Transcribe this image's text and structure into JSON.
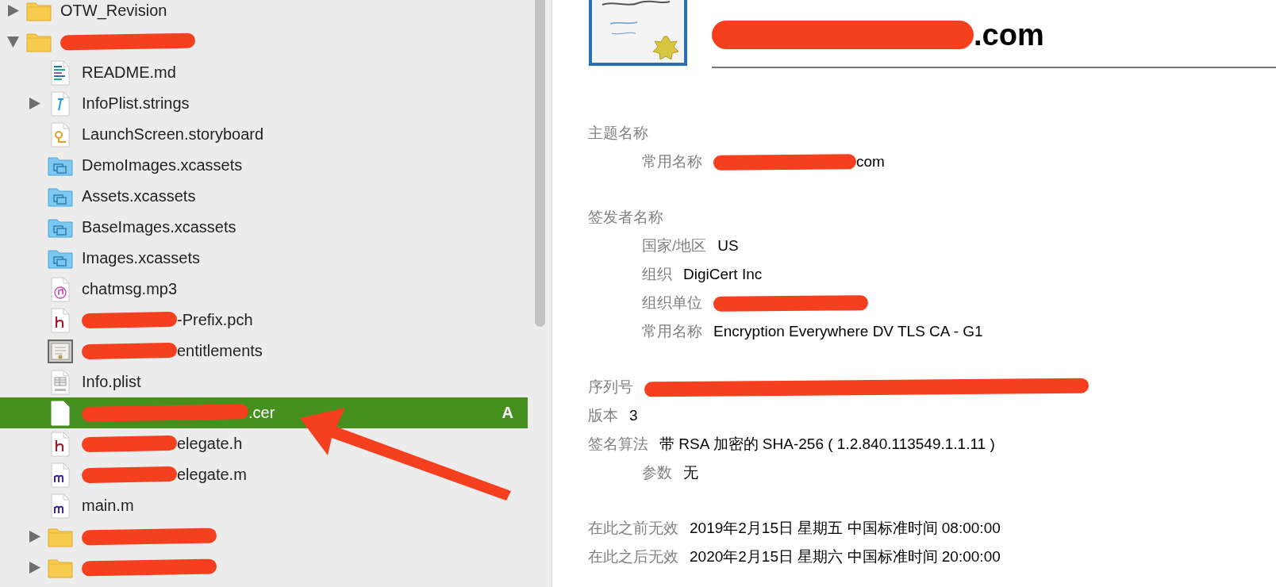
{
  "sidebar": {
    "items": [
      {
        "name": "OTW_Revision",
        "kind": "folder",
        "expanded": false
      },
      {
        "kind": "folder",
        "expanded": true,
        "redacted": true,
        "children": [
          {
            "name": "README.md",
            "kind": "markdown",
            "selected": false
          },
          {
            "name": "InfoPlist.strings",
            "kind": "strings",
            "expanded": false,
            "selected": false
          },
          {
            "name": "LaunchScreen.storyboard",
            "kind": "storyboard",
            "selected": false
          },
          {
            "name": "DemoImages.xcassets",
            "kind": "xcassets",
            "selected": false
          },
          {
            "name": "Assets.xcassets",
            "kind": "xcassets",
            "selected": false
          },
          {
            "name": "BaseImages.xcassets",
            "kind": "xcassets",
            "selected": false
          },
          {
            "name": "Images.xcassets",
            "kind": "xcassets",
            "selected": false
          },
          {
            "name": "chatmsg.mp3",
            "kind": "audio",
            "selected": false
          },
          {
            "name": "-Prefix.pch",
            "kind": "header",
            "redacted": true,
            "selected": false
          },
          {
            "name": "entitlements",
            "kind": "entitlements",
            "redacted": true,
            "selected": false
          },
          {
            "name": "Info.plist",
            "kind": "plist",
            "selected": false
          },
          {
            "name": ".cer",
            "kind": "certificate",
            "redacted": true,
            "selected": true,
            "badge": "A"
          },
          {
            "name": "elegate.h",
            "kind": "header",
            "redacted": true,
            "selected": false
          },
          {
            "name": "elegate.m",
            "kind": "implementation",
            "redacted": true,
            "selected": false
          },
          {
            "name": "main.m",
            "kind": "implementation",
            "selected": false
          },
          {
            "kind": "folder",
            "expanded": false,
            "redacted": true
          },
          {
            "kind": "folder",
            "expanded": false,
            "redacted": true
          }
        ]
      }
    ]
  },
  "certificate": {
    "title": ".com",
    "title_redacted": true,
    "sections": [
      {
        "rows": [
          {
            "label": "主题名称",
            "children": [
              {
                "label": "常用名称",
                "value": "com",
                "redacted": true
              }
            ]
          }
        ]
      },
      {
        "rows": [
          {
            "label": "签发者名称",
            "children": [
              {
                "label": "国家/地区",
                "value": "US"
              },
              {
                "label": "组织",
                "value": "DigiCert Inc"
              },
              {
                "label": "组织单位",
                "redacted": true
              },
              {
                "label": "常用名称",
                "value": "Encryption Everywhere DV TLS CA - G1"
              }
            ]
          }
        ]
      },
      {
        "rows": [
          {
            "label": "序列号",
            "redacted": true
          },
          {
            "label": "版本",
            "value": "3"
          },
          {
            "label": "签名算法",
            "value": "带 RSA 加密的 SHA-256 ( 1.2.840.113549.1.1.11 )",
            "children": [
              {
                "label": "参数",
                "value": "无"
              }
            ]
          }
        ]
      },
      {
        "rows": [
          {
            "label": "在此之前无效",
            "value": "2019年2月15日 星期五 中国标准时间 08:00:00"
          },
          {
            "label": "在此之后无效",
            "value": "2020年2月15日 星期六 中国标准时间 20:00:00"
          }
        ]
      }
    ]
  },
  "annotation": {
    "arrow": true
  }
}
